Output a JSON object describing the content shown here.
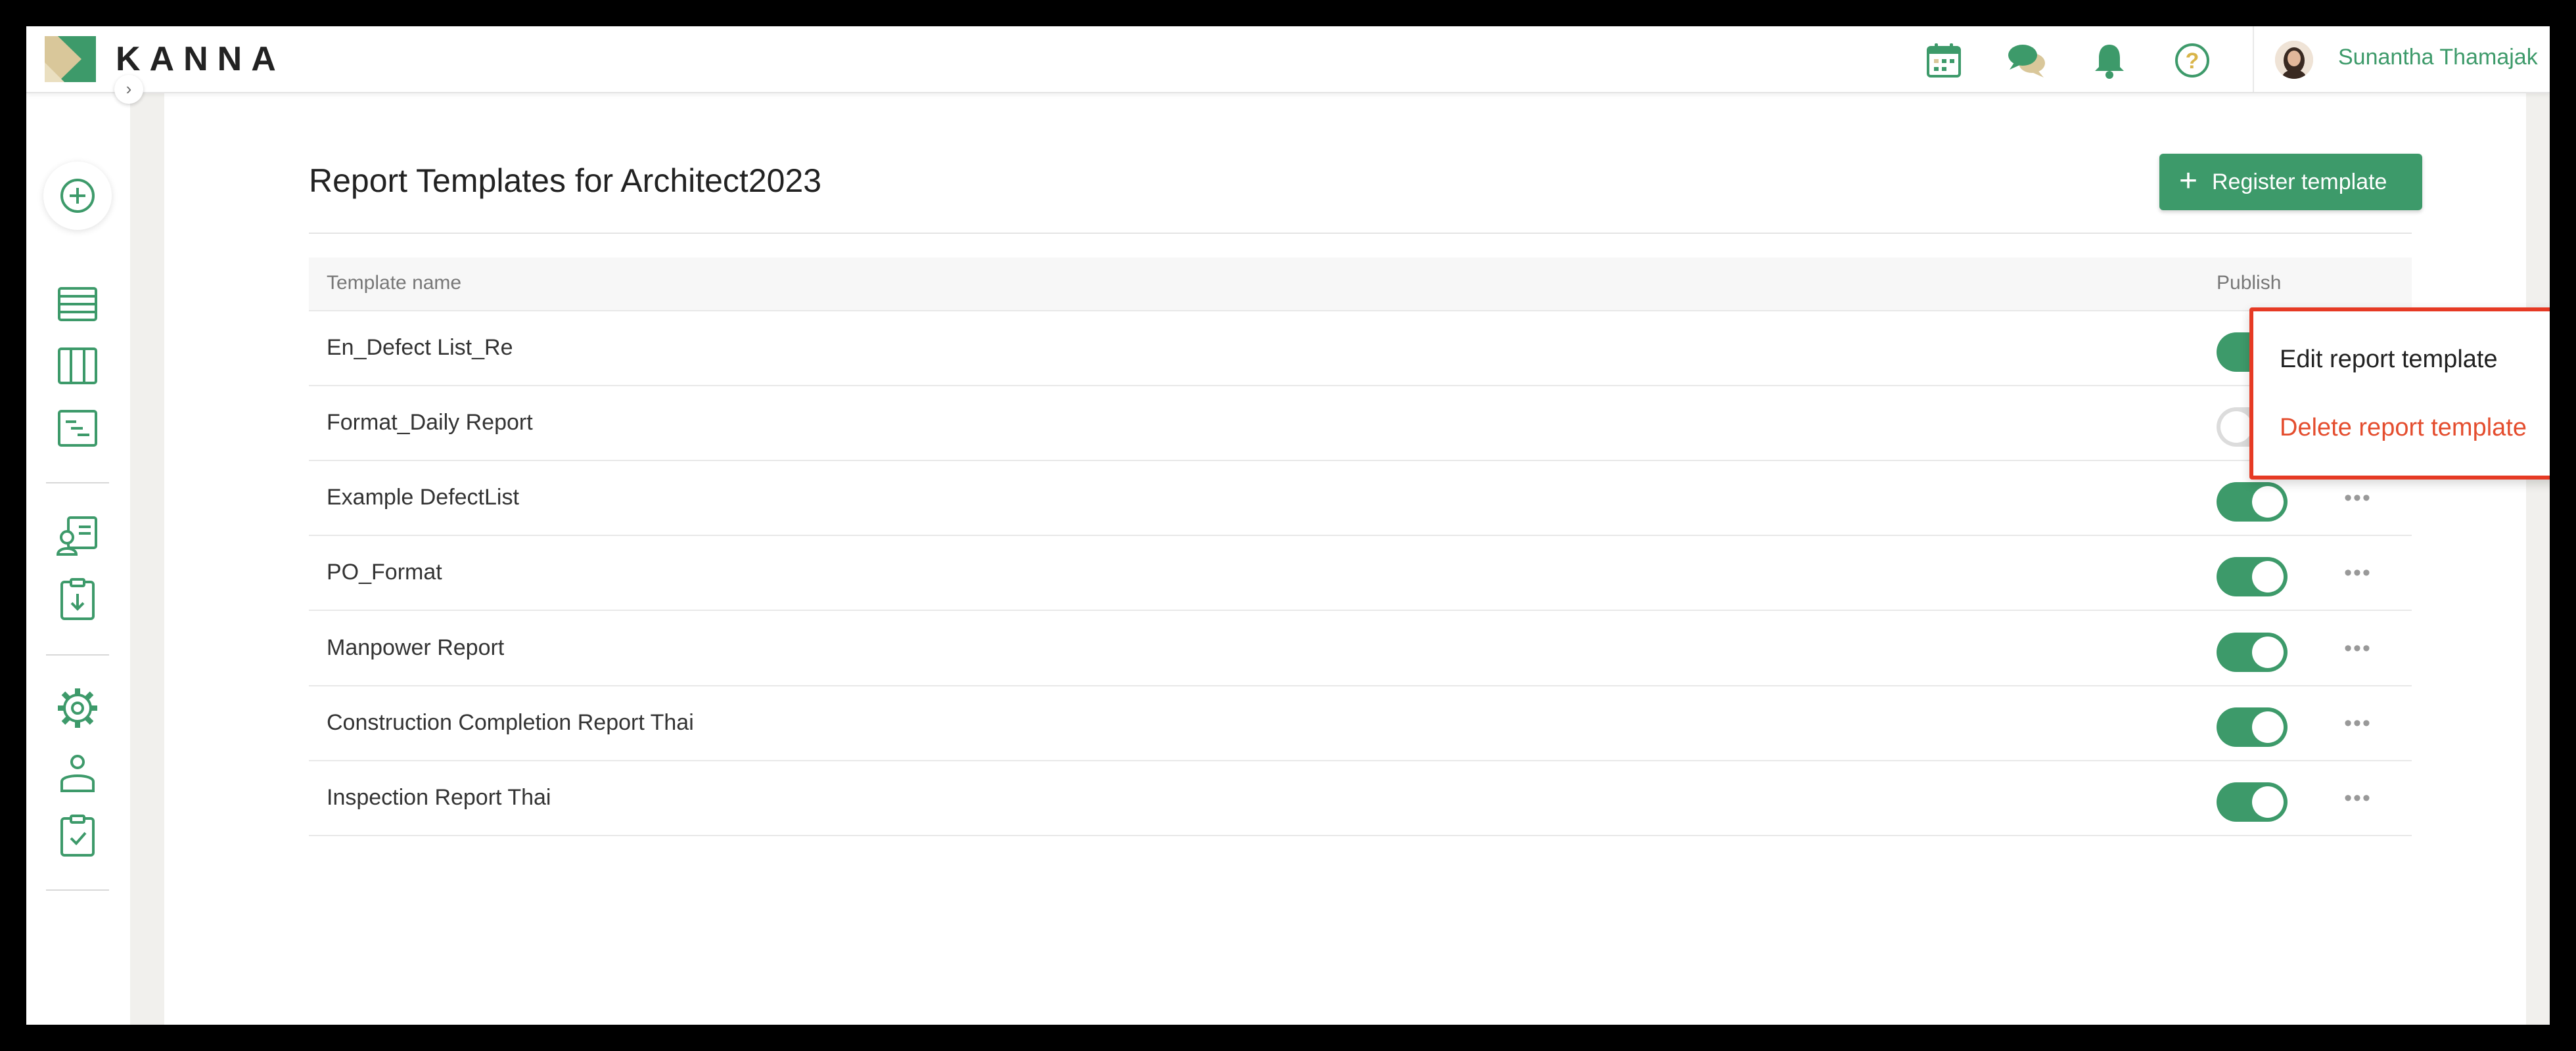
{
  "header": {
    "brand": "KANNA",
    "user_name": "Sunantha Thamajak",
    "icons": [
      "calendar-icon",
      "chat-icon",
      "bell-icon",
      "help-icon"
    ]
  },
  "sidebar": {
    "collapse_glyph": "›",
    "items": [
      "add-icon",
      "list-icon",
      "board-icon",
      "gantt-icon",
      "contact-icon",
      "download-clipboard-icon",
      "settings-icon",
      "user-icon",
      "checklist-icon"
    ]
  },
  "main": {
    "title": "Report Templates for Architect2023",
    "register_button": {
      "plus": "+",
      "label": "Register template"
    },
    "table": {
      "headers": {
        "name": "Template name",
        "publish": "Publish"
      },
      "more_glyph": "•••",
      "rows": [
        {
          "name": "En_Defect List_Re",
          "published": true
        },
        {
          "name": "Format_Daily Report",
          "published": false
        },
        {
          "name": "Example DefectList",
          "published": true
        },
        {
          "name": "PO_Format",
          "published": true
        },
        {
          "name": "Manpower Report",
          "published": true
        },
        {
          "name": "Construction Completion Report Thai",
          "published": true
        },
        {
          "name": "Inspection Report Thai",
          "published": true
        }
      ]
    }
  },
  "context_menu": {
    "edit_label": "Edit report template",
    "delete_label": "Delete report template"
  },
  "colors": {
    "brand_green": "#3d9a6a",
    "danger_red": "#e44d2e",
    "highlight_border": "#e63a24"
  }
}
